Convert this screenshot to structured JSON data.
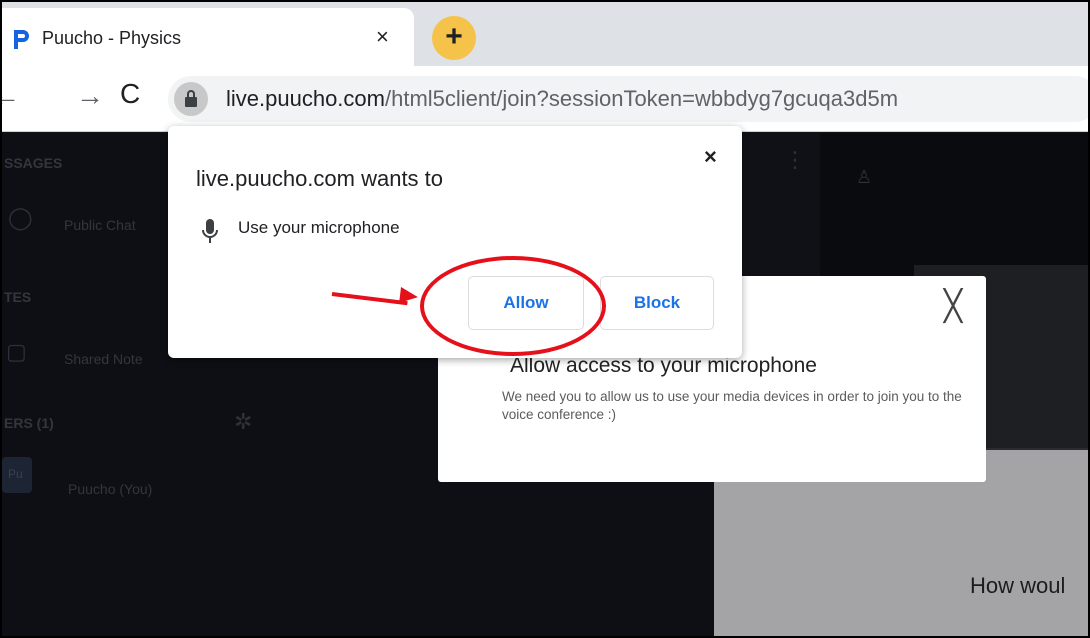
{
  "browser": {
    "tab_title": "Puucho - Physics",
    "tab_close": "×",
    "new_tab": "+",
    "back": "←",
    "forward": "→",
    "reload": "C",
    "url_host": "live.puucho.com",
    "url_path": "/html5client/join?sessionToken=wbbdyg7gcuqa3d5m"
  },
  "background": {
    "messages_header": "SSAGES",
    "public_chat": "Public Chat",
    "notes_header": "TES",
    "shared_notes": "Shared Note",
    "users_header": "ERS (1)",
    "user_name": "Puucho (You)",
    "avatar_initials": "Pu",
    "how_text": "How woul"
  },
  "permission_popup": {
    "title": "live.puucho.com wants to",
    "item": "Use your microphone",
    "allow": "Allow",
    "block": "Block",
    "close": "×"
  },
  "app_modal": {
    "close": "╳",
    "title": "Allow access to your microphone",
    "description": "We need you to allow us to use your media devices in order to join you to the voice conference :)"
  },
  "colors": {
    "accent_blue": "#1a73e8",
    "annotation_red": "#e5101a",
    "newtab_yellow": "#f6c34a"
  }
}
